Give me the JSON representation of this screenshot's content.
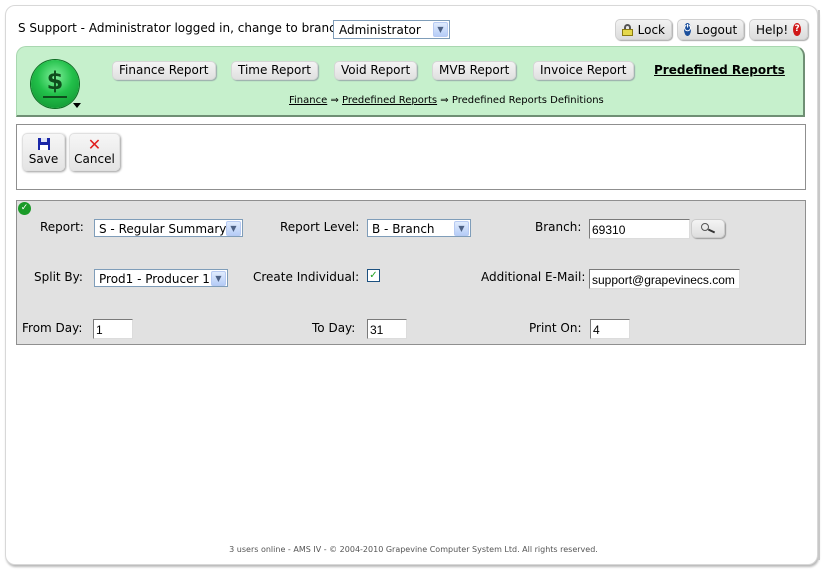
{
  "header": {
    "login_text": "S Support - Administrator logged in, change to branch:",
    "branch_select": {
      "value": "Administrator"
    },
    "buttons": {
      "lock": "Lock",
      "logout": "Logout",
      "help": "Help!"
    }
  },
  "nav": {
    "logo_icon": "dollar-coin-icon",
    "tabs": [
      {
        "label": "Finance Report"
      },
      {
        "label": "Time Report"
      },
      {
        "label": "Void Report"
      },
      {
        "label": "MVB Report"
      },
      {
        "label": "Invoice Report"
      }
    ],
    "active_tab": "Predefined Reports",
    "breadcrumb": {
      "items": [
        "Finance",
        "Predefined Reports"
      ],
      "separator": "⇒",
      "current": "Predefined Reports Definitions"
    }
  },
  "toolbar": {
    "save_label": "Save",
    "cancel_label": "Cancel"
  },
  "form": {
    "report": {
      "label": "Report:",
      "value": "S - Regular Summary"
    },
    "report_level": {
      "label": "Report Level:",
      "value": "B - Branch"
    },
    "branch": {
      "label": "Branch:",
      "value": "69310"
    },
    "split_by": {
      "label": "Split By:",
      "value": "Prod1 - Producer 1"
    },
    "create_individual": {
      "label": "Create Individual:",
      "checked": true
    },
    "additional_email": {
      "label": "Additional E-Mail:",
      "value": "support@grapevinecs.com"
    },
    "from_day": {
      "label": "From Day:",
      "value": "1"
    },
    "to_day": {
      "label": "To Day:",
      "value": "31"
    },
    "print_on": {
      "label": "Print On:",
      "value": "4"
    }
  },
  "footer": {
    "text": "3 users online - AMS IV - © 2004-2010 Grapevine Computer System Ltd. All rights reserved."
  }
}
